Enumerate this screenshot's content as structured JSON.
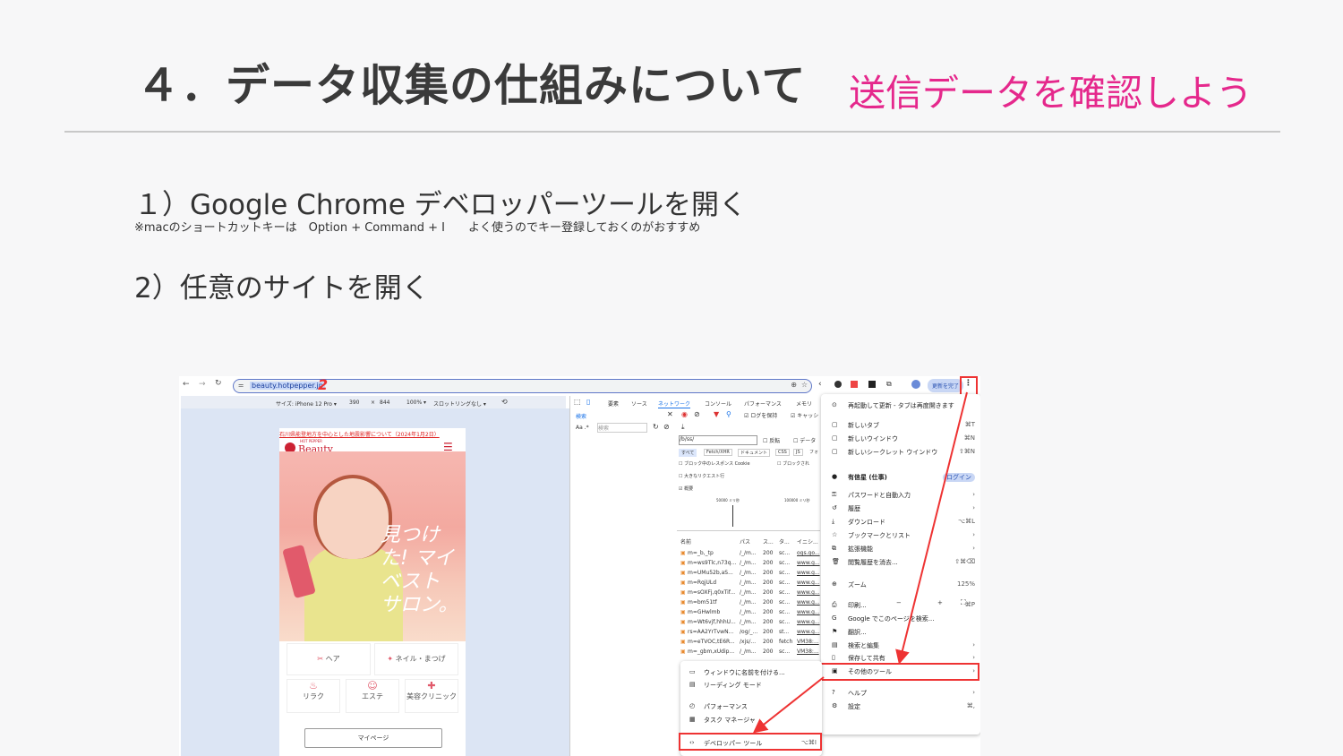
{
  "header": {
    "title": "４．データ収集の仕組みについて",
    "subtitle": "送信データを確認しよう"
  },
  "steps": {
    "step1": "１）Google Chrome デベロッパーツールを開く",
    "note": "※macのショートカットキーは　Option + Command + I　　よく使うのでキー登録しておくのがおすすめ",
    "step2": "2）任意のサイトを開く"
  },
  "browser": {
    "url": "beauty.hotpepper.jp",
    "update_button": "更新を完了",
    "device_bar": {
      "size_label": "サイズ: iPhone 12 Pro ▾",
      "width": "390",
      "times": "×",
      "height": "844",
      "zoom": "100% ▾",
      "throttle": "スロットリングなし ▾"
    },
    "site": {
      "notice": "石川県能登地方を中心とした地震影響について（2024年1月2日）",
      "logo_small": "HOT PEPPER",
      "logo": "Beauty",
      "catch": "見つけた! マイベスト サロン。",
      "categories": [
        "ヘア",
        "ネイル・まつげ",
        "リラク",
        "エステ",
        "美容クリニック"
      ],
      "mypage": "マイページ"
    },
    "devtools": {
      "tabs": [
        "要素",
        "ソース",
        "ネットワーク",
        "コンソール",
        "パフォーマンス",
        "メモリ"
      ],
      "search_label": "検索",
      "search_placeholder": "検索",
      "preserve_log": "ログを保持",
      "cache": "キャッシ",
      "filter_value": "/b/ss/",
      "invert": "反転",
      "data": "データ",
      "filters": [
        "すべて",
        "Fetch/XHR",
        "ドキュメント",
        "CSS",
        "JS",
        "フォ"
      ],
      "block_cookie": "ブロック中のレスポンス Cookie",
      "blocked": "ブロックされ",
      "large_rows": "大きなリクエスト行",
      "overview": "概要",
      "timeline_labels": [
        "50000 ミリ秒",
        "100000 ミリ秒"
      ],
      "columns": [
        "名前",
        "パス",
        "ス...",
        "タ...",
        "イニシ..."
      ],
      "rows": [
        [
          "m=_b,_tp",
          "/_/m...",
          "200",
          "sc...",
          "ogs.go..."
        ],
        [
          "m=ws9Tlc,n73q...",
          "/_/m...",
          "200",
          "sc...",
          "www.g..."
        ],
        [
          "m=UMu52b,aS...",
          "/_/m...",
          "200",
          "sc...",
          "www.g..."
        ],
        [
          "m=RqjULd",
          "/_/m...",
          "200",
          "sc...",
          "www.g..."
        ],
        [
          "m=sOXFj,q0xTif...",
          "/_/m...",
          "200",
          "sc...",
          "www.g..."
        ],
        [
          "m=bm51tf",
          "/_/m...",
          "200",
          "sc...",
          "www.g..."
        ],
        [
          "m=GHwlmb",
          "/_/m...",
          "200",
          "sc...",
          "www.g..."
        ],
        [
          "m=Wt6vjf,hhhU...",
          "/_/m...",
          "200",
          "sc...",
          "www.g..."
        ],
        [
          "rs=AA2YrTvwN...",
          "/og/_...",
          "200",
          "st...",
          "www.g..."
        ],
        [
          "m=eTVOC,tE6R...",
          "/xjs/...",
          "200",
          "fetch",
          "VM38:..."
        ],
        [
          "m=_gbm,xUdip...",
          "/_/m...",
          "200",
          "sc...",
          "VM38:..."
        ]
      ]
    },
    "menu": {
      "items": [
        {
          "label": "再起動して更新 - タブは再度開きます",
          "key": ""
        },
        {
          "label": "新しいタブ",
          "key": "⌘T"
        },
        {
          "label": "新しいウインドウ",
          "key": "⌘N"
        },
        {
          "label": "新しいシークレット ウインドウ",
          "key": "⇧⌘N"
        },
        {
          "label": "有信星 (仕事)",
          "key": "ログイン"
        },
        {
          "label": "パスワードと自動入力",
          "key": "›"
        },
        {
          "label": "履歴",
          "key": "›"
        },
        {
          "label": "ダウンロード",
          "key": "⌥⌘L"
        },
        {
          "label": "ブックマークとリスト",
          "key": "›"
        },
        {
          "label": "拡張機能",
          "key": "›"
        },
        {
          "label": "閲覧履歴を消去...",
          "key": "⇧⌘⌫"
        },
        {
          "label": "ズーム",
          "key": "125%"
        },
        {
          "label": "印刷...",
          "key": "⌘P"
        },
        {
          "label": "Google でこのページを検索...",
          "key": ""
        },
        {
          "label": "翻訳...",
          "key": ""
        },
        {
          "label": "検索と編集",
          "key": "›"
        },
        {
          "label": "保存して共有",
          "key": "›"
        },
        {
          "label": "その他のツール",
          "key": "›"
        },
        {
          "label": "ヘルプ",
          "key": "›"
        },
        {
          "label": "設定",
          "key": "⌘,"
        }
      ],
      "zoom_minus": "−",
      "zoom_plus": "+"
    },
    "submenu": {
      "items": [
        {
          "label": "ウィンドウに名前を付ける...",
          "key": ""
        },
        {
          "label": "リーディング モード",
          "key": ""
        },
        {
          "label": "パフォーマンス",
          "key": ""
        },
        {
          "label": "タスク マネージャ",
          "key": ""
        },
        {
          "label": "デベロッパー ツール",
          "key": "⌥⌘I"
        }
      ]
    },
    "markers": {
      "one": "1",
      "two": "2"
    }
  },
  "colors": {
    "accent": "#e5288c",
    "annotation": "#e33333"
  }
}
